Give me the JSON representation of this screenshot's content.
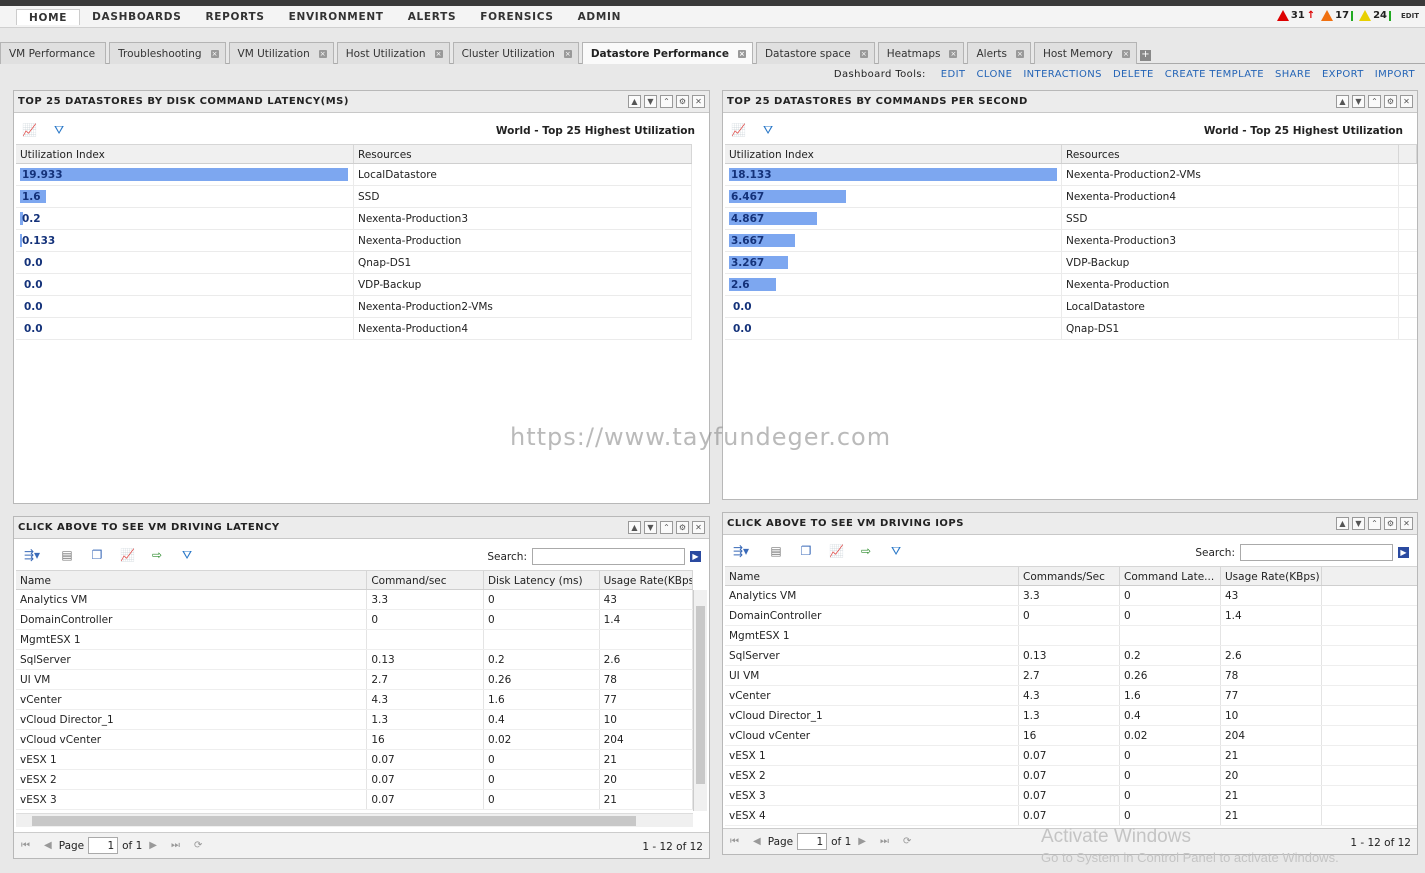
{
  "menu": [
    "HOME",
    "DASHBOARDS",
    "REPORTS",
    "ENVIRONMENT",
    "ALERTS",
    "FORENSICS",
    "ADMIN"
  ],
  "alerts": {
    "critical": "31",
    "immediate": "17",
    "warning": "24",
    "edit": "EDIT"
  },
  "tabs": [
    "VM Performance",
    "Troubleshooting",
    "VM Utilization",
    "Host Utilization",
    "Cluster Utilization",
    "Datastore Performance",
    "Datastore space",
    "Heatmaps",
    "Alerts",
    "Host Memory"
  ],
  "active_tab": "Datastore Performance",
  "tools": {
    "label": "Dashboard Tools:",
    "links": [
      "EDIT",
      "CLONE",
      "INTERACTIONS",
      "DELETE",
      "CREATE TEMPLATE",
      "SHARE",
      "EXPORT",
      "IMPORT"
    ]
  },
  "watermark": "https://www.tayfundeger.com",
  "activate": {
    "line1": "Activate Windows",
    "line2": "Go to System in Control Panel to activate Windows."
  },
  "panel_latency": {
    "title": "TOP 25 DATASTORES BY DISK COMMAND LATENCY(MS)",
    "scope": "World - Top 25 Highest Utilization",
    "col_index": "Utilization Index",
    "col_resources": "Resources",
    "rows": [
      {
        "value": "19.933",
        "resource": "LocalDatastore",
        "frac": 1.0
      },
      {
        "value": "1.6",
        "resource": "SSD",
        "frac": 0.08
      },
      {
        "value": "0.2",
        "resource": "Nexenta-Production3",
        "frac": 0.01
      },
      {
        "value": "0.133",
        "resource": "Nexenta-Production",
        "frac": 0.007
      },
      {
        "value": "0.0",
        "resource": "Qnap-DS1",
        "frac": 0
      },
      {
        "value": "0.0",
        "resource": "VDP-Backup",
        "frac": 0
      },
      {
        "value": "0.0",
        "resource": "Nexenta-Production2-VMs",
        "frac": 0
      },
      {
        "value": "0.0",
        "resource": "Nexenta-Production4",
        "frac": 0
      }
    ]
  },
  "panel_cps": {
    "title": "TOP 25 DATASTORES BY COMMANDS PER SECOND",
    "scope": "World - Top 25 Highest Utilization",
    "col_index": "Utilization Index",
    "col_resources": "Resources",
    "rows": [
      {
        "value": "18.133",
        "resource": "Nexenta-Production2-VMs",
        "frac": 1.0
      },
      {
        "value": "6.467",
        "resource": "Nexenta-Production4",
        "frac": 0.357
      },
      {
        "value": "4.867",
        "resource": "SSD",
        "frac": 0.268
      },
      {
        "value": "3.667",
        "resource": "Nexenta-Production3",
        "frac": 0.202
      },
      {
        "value": "3.267",
        "resource": "VDP-Backup",
        "frac": 0.18
      },
      {
        "value": "2.6",
        "resource": "Nexenta-Production",
        "frac": 0.143
      },
      {
        "value": "0.0",
        "resource": "LocalDatastore",
        "frac": 0
      },
      {
        "value": "0.0",
        "resource": "Qnap-DS1",
        "frac": 0
      }
    ]
  },
  "panel_vm_latency": {
    "title": "CLICK ABOVE TO SEE VM DRIVING LATENCY",
    "search_label": "Search:",
    "columns": [
      "Name",
      "Command/sec",
      "Disk Latency (ms)",
      "Usage Rate(KBps"
    ],
    "rows": [
      [
        "Analytics VM",
        "3.3",
        "0",
        "43"
      ],
      [
        "DomainController",
        "0",
        "0",
        "1.4"
      ],
      [
        "MgmtESX 1",
        "",
        "",
        ""
      ],
      [
        "SqlServer",
        "0.13",
        "0.2",
        "2.6"
      ],
      [
        "UI VM",
        "2.7",
        "0.26",
        "78"
      ],
      [
        "vCenter",
        "4.3",
        "1.6",
        "77"
      ],
      [
        "vCloud Director_1",
        "1.3",
        "0.4",
        "10"
      ],
      [
        "vCloud vCenter",
        "16",
        "0.02",
        "204"
      ],
      [
        "vESX 1",
        "0.07",
        "0",
        "21"
      ],
      [
        "vESX 2",
        "0.07",
        "0",
        "20"
      ],
      [
        "vESX 3",
        "0.07",
        "0",
        "21"
      ]
    ],
    "pager": {
      "page_label": "Page",
      "page": "1",
      "of": "of 1",
      "count": "1 - 12 of 12"
    }
  },
  "panel_vm_iops": {
    "title": "CLICK ABOVE TO SEE VM DRIVING IOPS",
    "search_label": "Search:",
    "columns": [
      "Name",
      "Commands/Sec",
      "Command Late...",
      "Usage Rate(KBps)"
    ],
    "rows": [
      [
        "Analytics VM",
        "3.3",
        "0",
        "43"
      ],
      [
        "DomainController",
        "0",
        "0",
        "1.4"
      ],
      [
        "MgmtESX 1",
        "",
        "",
        ""
      ],
      [
        "SqlServer",
        "0.13",
        "0.2",
        "2.6"
      ],
      [
        "UI VM",
        "2.7",
        "0.26",
        "78"
      ],
      [
        "vCenter",
        "4.3",
        "1.6",
        "77"
      ],
      [
        "vCloud Director_1",
        "1.3",
        "0.4",
        "10"
      ],
      [
        "vCloud vCenter",
        "16",
        "0.02",
        "204"
      ],
      [
        "vESX 1",
        "0.07",
        "0",
        "21"
      ],
      [
        "vESX 2",
        "0.07",
        "0",
        "20"
      ],
      [
        "vESX 3",
        "0.07",
        "0",
        "21"
      ],
      [
        "vESX 4",
        "0.07",
        "0",
        "21"
      ]
    ],
    "pager": {
      "page_label": "Page",
      "page": "1",
      "of": "of 1",
      "count": "1 - 12 of 12"
    }
  }
}
